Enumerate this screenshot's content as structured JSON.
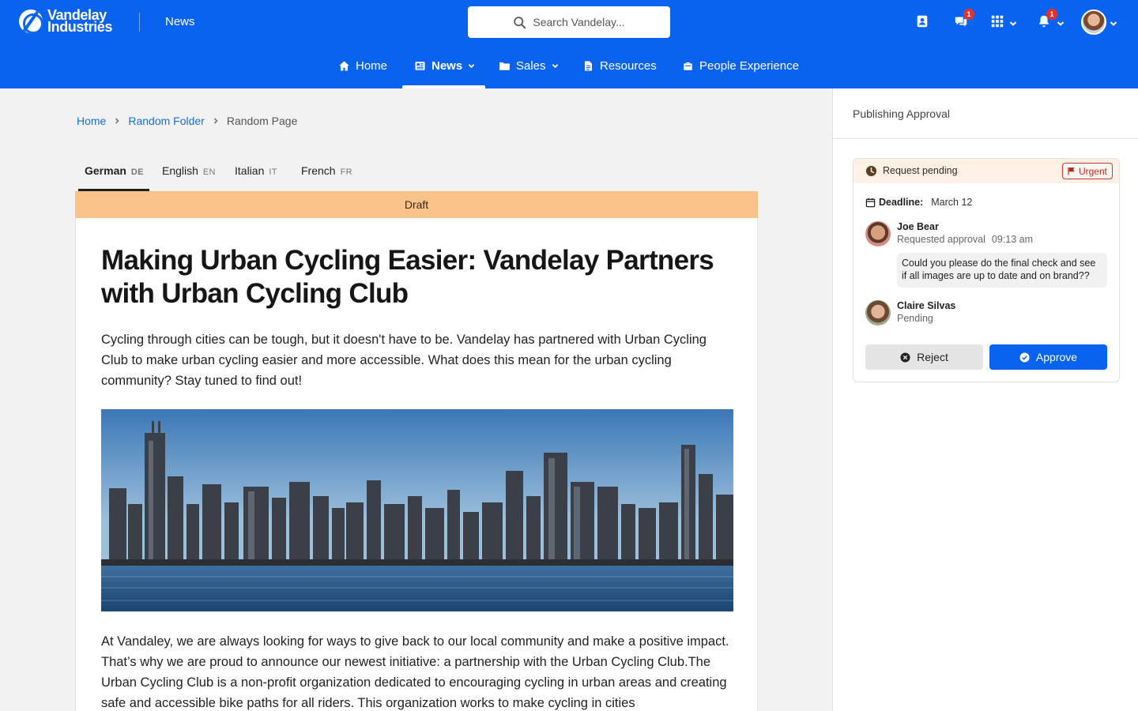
{
  "header": {
    "logo_line1": "Vandelay",
    "logo_line2": "Industries",
    "site_name": "News",
    "search_placeholder": "Search Vandelay...",
    "chat_badge": "1",
    "notif_badge": "1",
    "brand_color": "#0a63f0"
  },
  "nav": {
    "items": [
      {
        "label": "Home",
        "icon": "home-icon"
      },
      {
        "label": "News",
        "icon": "newspaper-icon",
        "active": true
      },
      {
        "label": "Sales",
        "icon": "folder-icon"
      },
      {
        "label": "Resources",
        "icon": "document-icon"
      },
      {
        "label": "People Experience",
        "icon": "briefcase-icon"
      }
    ]
  },
  "breadcrumb": [
    "Home",
    "Random Folder",
    "Random Page"
  ],
  "languages": [
    {
      "label": "German",
      "code": "DE",
      "active": true
    },
    {
      "label": "English",
      "code": "EN"
    },
    {
      "label": "Italian",
      "code": "IT"
    },
    {
      "label": "French",
      "code": "FR"
    }
  ],
  "article": {
    "status": "Draft",
    "title": "Making Urban Cycling Easier: Vandelay Partners with Urban Cycling Club",
    "intro": "Cycling through cities can be tough, but it doesn't have to be. Vandelay has partnered with Urban Cycling Club to make urban cycling easier and more accessible. What does this mean for the urban cycling community? Stay tuned to find out!",
    "body": "At Vandaley, we are always looking for ways to give back to our local community and make a positive impact. That’s why we are proud to announce our newest initiative: a partnership with the Urban Cycling Club.The Urban Cycling Club is a non-profit organization dedicated to encouraging cycling in urban areas and creating safe and accessible bike paths for all riders. This organization works to make cycling in cities"
  },
  "approval": {
    "panel_title": "Publishing Approval",
    "status": "Request pending",
    "priority": "Urgent",
    "deadline_label": "Deadline:",
    "deadline_value": "March 12",
    "requester": {
      "name": "Joe Bear",
      "action": "Requested approval",
      "time": "09:13 am",
      "comment": "Could you please do the final check and see if all images are up to date and on brand??"
    },
    "approver": {
      "name": "Claire Silvas",
      "status": "Pending"
    },
    "reject_label": "Reject",
    "approve_label": "Approve"
  }
}
